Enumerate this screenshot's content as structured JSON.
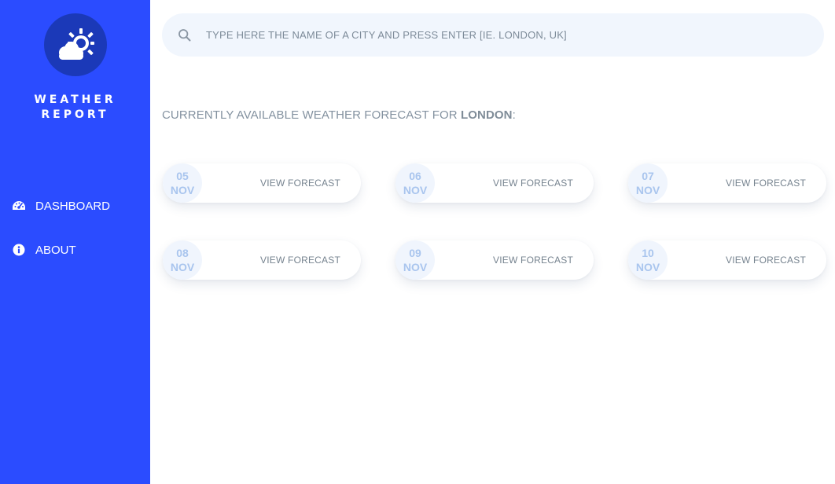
{
  "brand": {
    "line1": "WEATHER",
    "line2": "REPORT",
    "logo_icon": "cloud-sun-icon",
    "color": "#2b4cff",
    "logo_bg": "#1b39b8"
  },
  "sidebar": {
    "items": [
      {
        "label": "DASHBOARD",
        "icon": "dashboard-gauge-icon"
      },
      {
        "label": "ABOUT",
        "icon": "info-circle-icon"
      }
    ]
  },
  "search": {
    "placeholder": "TYPE HERE THE NAME OF A CITY AND PRESS ENTER [IE. LONDON, UK]",
    "icon": "search-icon"
  },
  "heading": {
    "prefix": "CURRENTLY AVAILABLE WEATHER FORECAST FOR ",
    "city": "LONDON",
    "suffix": ":"
  },
  "forecasts": [
    {
      "day": "05",
      "month": "NOV",
      "action": "VIEW FORECAST"
    },
    {
      "day": "06",
      "month": "NOV",
      "action": "VIEW FORECAST"
    },
    {
      "day": "07",
      "month": "NOV",
      "action": "VIEW FORECAST"
    },
    {
      "day": "08",
      "month": "NOV",
      "action": "VIEW FORECAST"
    },
    {
      "day": "09",
      "month": "NOV",
      "action": "VIEW FORECAST"
    },
    {
      "day": "10",
      "month": "NOV",
      "action": "VIEW FORECAST"
    }
  ]
}
